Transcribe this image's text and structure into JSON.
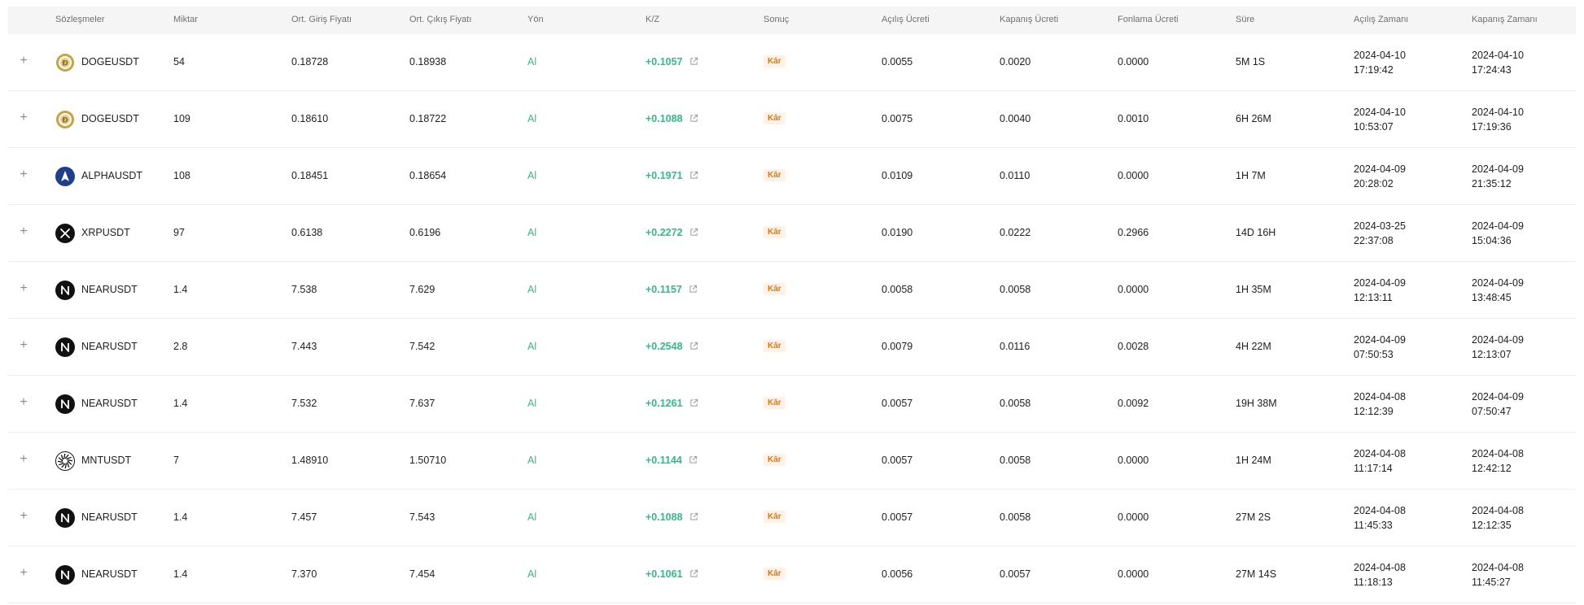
{
  "headers": {
    "contracts": "Sözleşmeler",
    "quantity": "Miktar",
    "avg_entry": "Ort. Giriş Fiyatı",
    "avg_exit": "Ort. Çıkış Fiyatı",
    "direction": "Yön",
    "pnl": "K/Z",
    "result": "Sonuç",
    "open_fee": "Açılış Ücreti",
    "close_fee": "Kapanış Ücreti",
    "funding_fee": "Fonlama Ücreti",
    "duration": "Süre",
    "open_time": "Açılış Zamanı",
    "close_time": "Kapanış Zamanı"
  },
  "colors": {
    "profit": "#2ebd85",
    "badge_text": "#e07a10",
    "badge_bg": "#fff1e6"
  },
  "expand_symbol": "+",
  "rows": [
    {
      "coin": "DOGEUSDT",
      "icon": "doge-coin-icon",
      "qty": "54",
      "entry": "0.18728",
      "exit": "0.18938",
      "dir": "Al",
      "pnl": "+0.1057",
      "result": "Kâr",
      "open_fee": "0.0055",
      "close_fee": "0.0020",
      "funding": "0.0000",
      "duration": "5M 1S",
      "open_date": "2024-04-10",
      "open_clock": "17:19:42",
      "close_date": "2024-04-10",
      "close_clock": "17:24:43"
    },
    {
      "coin": "DOGEUSDT",
      "icon": "doge-coin-icon",
      "qty": "109",
      "entry": "0.18610",
      "exit": "0.18722",
      "dir": "Al",
      "pnl": "+0.1088",
      "result": "Kâr",
      "open_fee": "0.0075",
      "close_fee": "0.0040",
      "funding": "0.0010",
      "duration": "6H 26M",
      "open_date": "2024-04-10",
      "open_clock": "10:53:07",
      "close_date": "2024-04-10",
      "close_clock": "17:19:36"
    },
    {
      "coin": "ALPHAUSDT",
      "icon": "alpha-coin-icon",
      "qty": "108",
      "entry": "0.18451",
      "exit": "0.18654",
      "dir": "Al",
      "pnl": "+0.1971",
      "result": "Kâr",
      "open_fee": "0.0109",
      "close_fee": "0.0110",
      "funding": "0.0000",
      "duration": "1H 7M",
      "open_date": "2024-04-09",
      "open_clock": "20:28:02",
      "close_date": "2024-04-09",
      "close_clock": "21:35:12"
    },
    {
      "coin": "XRPUSDT",
      "icon": "xrp-coin-icon",
      "qty": "97",
      "entry": "0.6138",
      "exit": "0.6196",
      "dir": "Al",
      "pnl": "+0.2272",
      "result": "Kâr",
      "open_fee": "0.0190",
      "close_fee": "0.0222",
      "funding": "0.2966",
      "duration": "14D 16H",
      "open_date": "2024-03-25",
      "open_clock": "22:37:08",
      "close_date": "2024-04-09",
      "close_clock": "15:04:36"
    },
    {
      "coin": "NEARUSDT",
      "icon": "near-coin-icon",
      "qty": "1.4",
      "entry": "7.538",
      "exit": "7.629",
      "dir": "Al",
      "pnl": "+0.1157",
      "result": "Kâr",
      "open_fee": "0.0058",
      "close_fee": "0.0058",
      "funding": "0.0000",
      "duration": "1H 35M",
      "open_date": "2024-04-09",
      "open_clock": "12:13:11",
      "close_date": "2024-04-09",
      "close_clock": "13:48:45"
    },
    {
      "coin": "NEARUSDT",
      "icon": "near-coin-icon",
      "qty": "2.8",
      "entry": "7.443",
      "exit": "7.542",
      "dir": "Al",
      "pnl": "+0.2548",
      "result": "Kâr",
      "open_fee": "0.0079",
      "close_fee": "0.0116",
      "funding": "0.0028",
      "duration": "4H 22M",
      "open_date": "2024-04-09",
      "open_clock": "07:50:53",
      "close_date": "2024-04-09",
      "close_clock": "12:13:07"
    },
    {
      "coin": "NEARUSDT",
      "icon": "near-coin-icon",
      "qty": "1.4",
      "entry": "7.532",
      "exit": "7.637",
      "dir": "Al",
      "pnl": "+0.1261",
      "result": "Kâr",
      "open_fee": "0.0057",
      "close_fee": "0.0058",
      "funding": "0.0092",
      "duration": "19H 38M",
      "open_date": "2024-04-08",
      "open_clock": "12:12:39",
      "close_date": "2024-04-09",
      "close_clock": "07:50:47"
    },
    {
      "coin": "MNTUSDT",
      "icon": "mnt-coin-icon",
      "qty": "7",
      "entry": "1.48910",
      "exit": "1.50710",
      "dir": "Al",
      "pnl": "+0.1144",
      "result": "Kâr",
      "open_fee": "0.0057",
      "close_fee": "0.0058",
      "funding": "0.0000",
      "duration": "1H 24M",
      "open_date": "2024-04-08",
      "open_clock": "11:17:14",
      "close_date": "2024-04-08",
      "close_clock": "12:42:12"
    },
    {
      "coin": "NEARUSDT",
      "icon": "near-coin-icon",
      "qty": "1.4",
      "entry": "7.457",
      "exit": "7.543",
      "dir": "Al",
      "pnl": "+0.1088",
      "result": "Kâr",
      "open_fee": "0.0057",
      "close_fee": "0.0058",
      "funding": "0.0000",
      "duration": "27M 2S",
      "open_date": "2024-04-08",
      "open_clock": "11:45:33",
      "close_date": "2024-04-08",
      "close_clock": "12:12:35"
    },
    {
      "coin": "NEARUSDT",
      "icon": "near-coin-icon",
      "qty": "1.4",
      "entry": "7.370",
      "exit": "7.454",
      "dir": "Al",
      "pnl": "+0.1061",
      "result": "Kâr",
      "open_fee": "0.0056",
      "close_fee": "0.0057",
      "funding": "0.0000",
      "duration": "27M 14S",
      "open_date": "2024-04-08",
      "open_clock": "11:18:13",
      "close_date": "2024-04-08",
      "close_clock": "11:45:27"
    }
  ]
}
